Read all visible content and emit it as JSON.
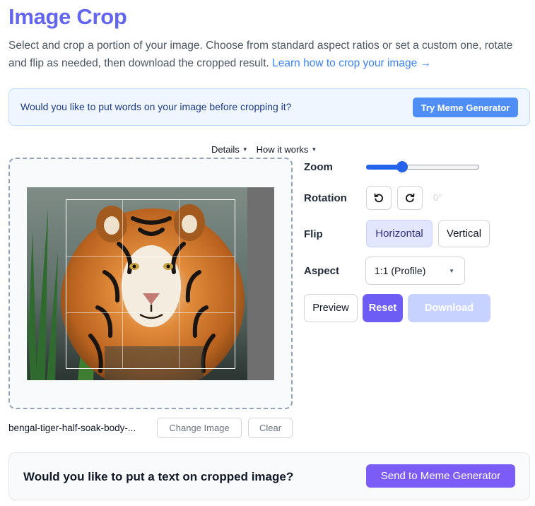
{
  "page": {
    "title": "Image Crop",
    "intro": "Select and crop a portion of your image. Choose from standard aspect ratios or set a custom one, rotate and flip as needed, then download the cropped result.",
    "learn_link": "Learn how to crop your image →"
  },
  "banner": {
    "text": "Would you like to put words on your image before cropping it?",
    "button": "Try Meme Generator"
  },
  "toggles": {
    "details": "Details",
    "how_it_works": "How it works"
  },
  "file": {
    "name": "bengal-tiger-half-soak-body-...",
    "change_button": "Change Image",
    "clear_button": "Clear"
  },
  "controls": {
    "zoom_label": "Zoom",
    "zoom_level": 0.32,
    "rotation_label": "Rotation",
    "rotation_value": "0°",
    "rotate_left_icon": "rotate-left-icon",
    "rotate_right_icon": "rotate-right-icon",
    "flip_label": "Flip",
    "flip_horizontal": "Horizontal",
    "flip_vertical": "Vertical",
    "flip_active": "horizontal",
    "aspect_label": "Aspect",
    "aspect_value": "1:1 (Profile)",
    "preview_button": "Preview",
    "reset_button": "Reset",
    "download_button": "Download"
  },
  "bottom": {
    "text": "Would you like to put a text on cropped image?",
    "button": "Send to Meme Generator"
  },
  "colors": {
    "accent": "#6366f1",
    "link": "#3b82f6",
    "reset": "#6d5df5",
    "download_disabled": "#c7d2fe",
    "send": "#7c5cf6"
  }
}
